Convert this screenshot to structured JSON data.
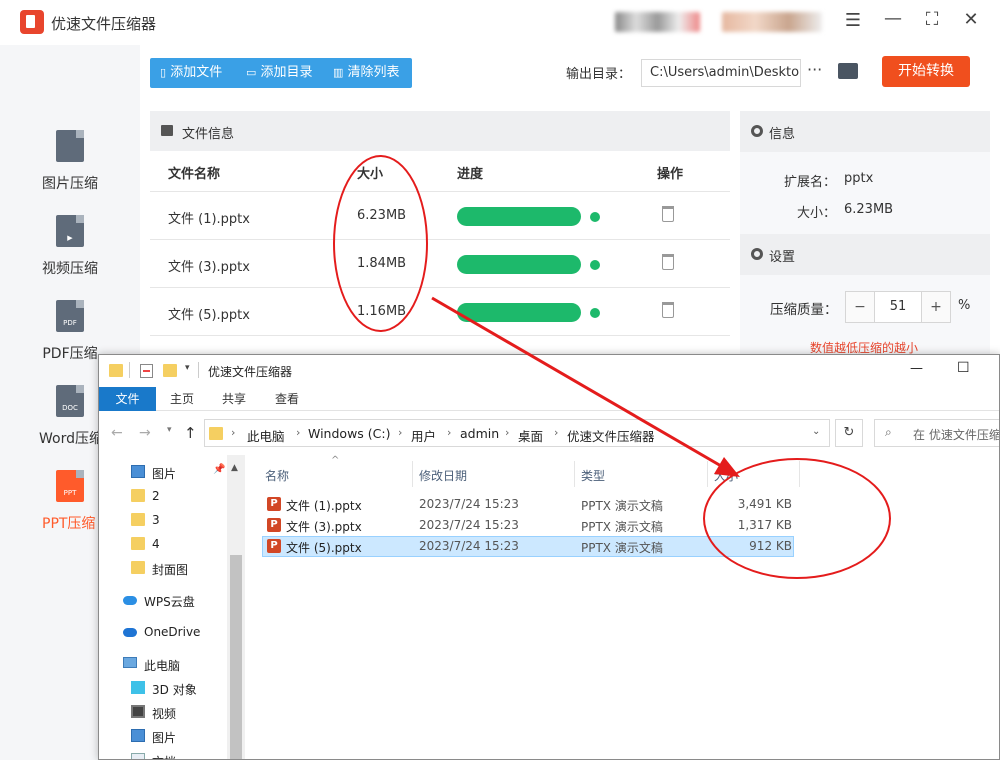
{
  "app": {
    "title": "优速文件压缩器",
    "window_controls": [
      "☰",
      "—",
      "⛶",
      "✕"
    ]
  },
  "sidebar": {
    "items": [
      {
        "label": "图片压缩",
        "icon": "image-file-icon",
        "tag": ""
      },
      {
        "label": "视频压缩",
        "icon": "video-file-icon",
        "tag": "▶"
      },
      {
        "label": "PDF压缩",
        "icon": "pdf-file-icon",
        "tag": "PDF"
      },
      {
        "label": "Word压缩",
        "icon": "doc-file-icon",
        "tag": "DOC"
      },
      {
        "label": "PPT压缩",
        "icon": "ppt-file-icon",
        "tag": "PPT",
        "active": true
      }
    ]
  },
  "toolbar": {
    "add_file": "添加文件",
    "add_dir": "添加目录",
    "clear_list": "清除列表",
    "output_label": "输出目录：",
    "output_value": "C:\\Users\\admin\\Deskto",
    "more": "···",
    "start": "开始转换"
  },
  "file_list": {
    "header": "文件信息",
    "columns": {
      "name": "文件名称",
      "size": "大小",
      "progress": "进度",
      "action": "操作"
    },
    "rows": [
      {
        "name": "文件 (1).pptx",
        "size": "6.23MB",
        "progress": 1.0
      },
      {
        "name": "文件 (3).pptx",
        "size": "1.84MB",
        "progress": 1.0
      },
      {
        "name": "文件 (5).pptx",
        "size": "1.16MB",
        "progress": 1.0
      }
    ]
  },
  "info": {
    "header": "信息",
    "ext_label": "扩展名：",
    "ext_value": "pptx",
    "size_label": "大小：",
    "size_value": "6.23MB"
  },
  "settings": {
    "header": "设置",
    "quality_label": "压缩质量：",
    "minus": "−",
    "value": "51",
    "plus": "+",
    "percent": "%",
    "hint": "数值越低压缩的越小"
  },
  "explorer": {
    "title": "优速文件压缩器",
    "controls": [
      "—",
      "☐"
    ],
    "ribbon_tabs": [
      "文件",
      "主页",
      "共享",
      "查看"
    ],
    "breadcrumb": [
      "此电脑",
      "Windows (C:)",
      "用户",
      "admin",
      "桌面",
      "优速文件压缩器"
    ],
    "search_placeholder": "在 优速文件压缩器",
    "nav": [
      {
        "label": "图片",
        "icon": "pictures-icon"
      },
      {
        "label": "2",
        "icon": "folder-icon"
      },
      {
        "label": "3",
        "icon": "folder-icon"
      },
      {
        "label": "4",
        "icon": "folder-icon"
      },
      {
        "label": "封面图",
        "icon": "folder-icon"
      },
      {
        "label": "WPS云盘",
        "icon": "wps-cloud-icon"
      },
      {
        "label": "OneDrive",
        "icon": "onedrive-icon"
      },
      {
        "label": "此电脑",
        "icon": "this-pc-icon"
      },
      {
        "label": "3D 对象",
        "icon": "3d-objects-icon"
      },
      {
        "label": "视频",
        "icon": "videos-icon"
      },
      {
        "label": "图片",
        "icon": "pictures-icon"
      },
      {
        "label": "文档",
        "icon": "documents-icon"
      }
    ],
    "columns": {
      "name": "名称",
      "date": "修改日期",
      "type": "类型",
      "size": "大小"
    },
    "files": [
      {
        "name": "文件 (1).pptx",
        "date": "2023/7/24 15:23",
        "type": "PPTX 演示文稿",
        "size": "3,491 KB",
        "selected": false
      },
      {
        "name": "文件 (3).pptx",
        "date": "2023/7/24 15:23",
        "type": "PPTX 演示文稿",
        "size": "1,317 KB",
        "selected": false
      },
      {
        "name": "文件 (5).pptx",
        "date": "2023/7/24 15:23",
        "type": "PPTX 演示文稿",
        "size": "912 KB",
        "selected": true
      }
    ]
  },
  "colors": {
    "accent_blue": "#3aa0e6",
    "start_orange": "#f04f1e",
    "progress_green": "#1db96b",
    "annotation_red": "#e41c1c",
    "active_side": "#ff5b2b"
  }
}
